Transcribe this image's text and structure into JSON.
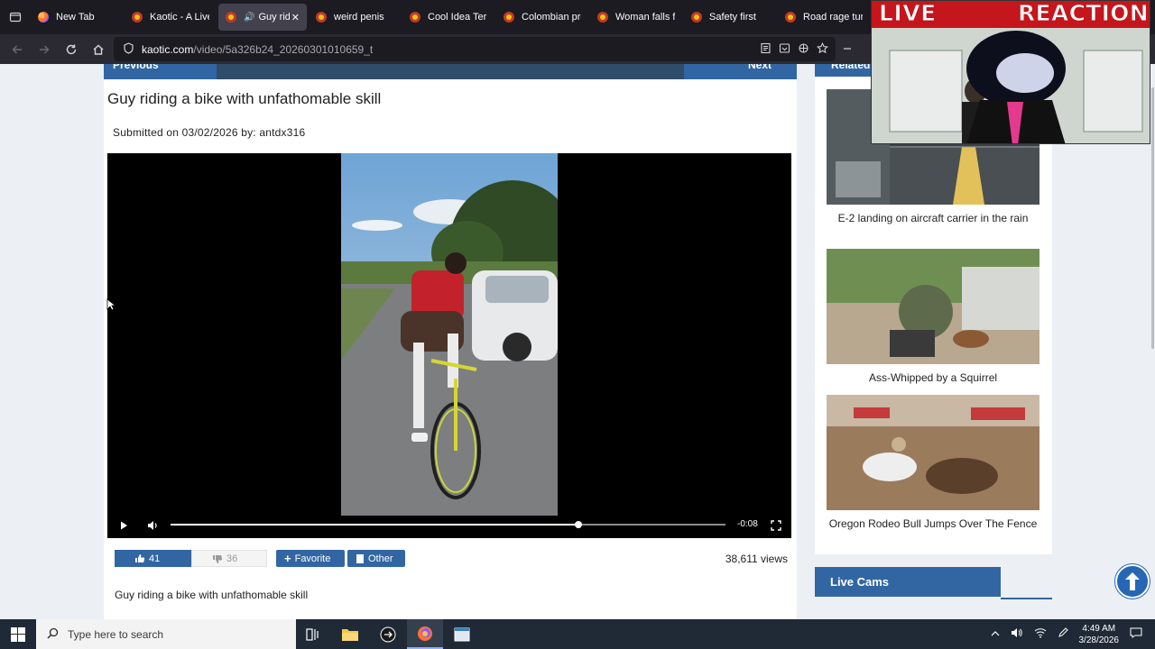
{
  "browser": {
    "tabs": [
      {
        "label": "New Tab",
        "favicon": "firefox-icon",
        "active": false
      },
      {
        "label": "Kaotic - A Live",
        "favicon": "kaotic-icon",
        "active": false
      },
      {
        "label": "Guy ridi",
        "favicon": "kaotic-icon",
        "active": true,
        "audio": true
      },
      {
        "label": "weird penis",
        "favicon": "kaotic-icon",
        "active": false
      },
      {
        "label": "Cool Idea Terri",
        "favicon": "kaotic-icon",
        "active": false
      },
      {
        "label": "Colombian pro",
        "favicon": "kaotic-icon",
        "active": false
      },
      {
        "label": "Woman falls fr",
        "favicon": "kaotic-icon",
        "active": false
      },
      {
        "label": "Safety first",
        "favicon": "kaotic-icon",
        "active": false
      },
      {
        "label": "Road rage turn",
        "favicon": "kaotic-icon",
        "active": false
      }
    ],
    "url_domain": "kaotic.com",
    "url_path": "/video/5a326b24_20260301010659_t"
  },
  "page": {
    "prev_label": "Previous",
    "next_label": "Next",
    "related_label": "Related",
    "title": "Guy riding a bike with unfathomable skill",
    "submitted": "Submitted on 03/02/2026 by: antdx316",
    "player": {
      "time": "-0:08",
      "progress": 0.735
    },
    "likes": "41",
    "dislikes": "36",
    "favorite_label": "Favorite",
    "other_label": "Other",
    "views": "38,611 views",
    "description": "Guy riding a bike with unfathomable skill",
    "related": [
      {
        "title": "E-2 landing on aircraft carrier in the rain"
      },
      {
        "title": "Ass-Whipped by a Squirrel"
      },
      {
        "title": "Oregon Rodeo Bull Jumps Over The Fence"
      }
    ],
    "live_cams_label": "Live Cams"
  },
  "overlay": {
    "live": "LIVE",
    "reaction": "REACTION"
  },
  "taskbar": {
    "search_placeholder": "Type here to search",
    "time": "4:49 AM",
    "date": "3/28/2026"
  },
  "colors": {
    "accent": "#3266a3",
    "accent_dark": "#2f4d6b",
    "browser_tabstrip": "#1c1b22",
    "browser_nav": "#2b2a33",
    "taskbar": "#1f2a36",
    "live_red": "#c4161c"
  }
}
